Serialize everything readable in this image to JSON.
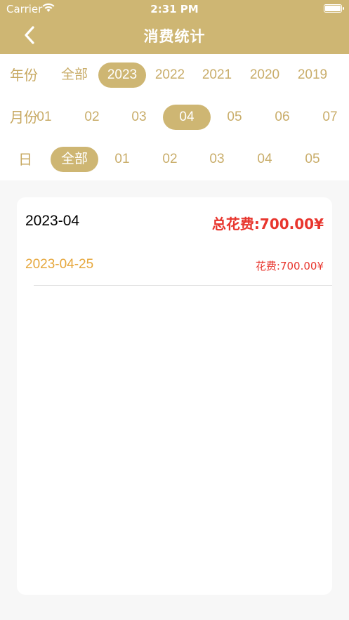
{
  "status_bar": {
    "carrier": "Carrier",
    "time": "2:31 PM"
  },
  "nav": {
    "title": "消费统计"
  },
  "filters": {
    "year": {
      "label": "年份",
      "options": [
        "全部",
        "2023",
        "2022",
        "2021",
        "2020",
        "2019"
      ],
      "selected": "2023"
    },
    "month": {
      "label": "月份",
      "options": [
        "01",
        "02",
        "03",
        "04",
        "05",
        "06",
        "07"
      ],
      "selected": "04"
    },
    "day": {
      "label": "日",
      "options": [
        "全部",
        "01",
        "02",
        "03",
        "04",
        "05"
      ],
      "selected": "全部"
    }
  },
  "summary": {
    "month": "2023-04",
    "total": "总花费:700.00¥",
    "entries": [
      {
        "date": "2023-04-25",
        "cost": "花费:700.00¥"
      }
    ]
  },
  "colors": {
    "brand": "#ceb673",
    "accent_text": "#c9ad6a",
    "cost_red": "#e8352d",
    "date_orange": "#e6a73c"
  }
}
